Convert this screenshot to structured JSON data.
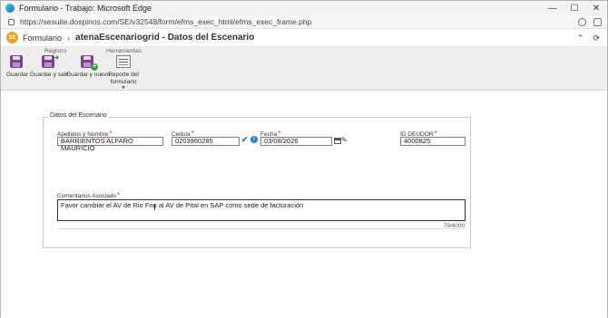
{
  "window": {
    "title": "Formulario - Trabajo: Microsoft Edge",
    "url": "https://sesuite.dospinos.com/SE/v32548/form/efms_exec_html/efms_exec_frame.php"
  },
  "header": {
    "logo_text": "SE",
    "breadcrumb_root": "Formulario",
    "separator": "›",
    "page_title": "atenaEscenariogrid - Datos del Escenario"
  },
  "ribbon": {
    "groups": [
      {
        "label": "Registro"
      },
      {
        "label": "Herramientas"
      }
    ],
    "buttons": [
      {
        "label": "Guardar"
      },
      {
        "label": "Guardar y salir"
      },
      {
        "label": "Guardar y nuevo"
      },
      {
        "label": "Reporte del formulario"
      }
    ]
  },
  "form": {
    "section_title": "Datos del Escenario",
    "fields": {
      "nombre": {
        "label": "Apellidos y Nombre",
        "value": "BARRIENTOS ALFARO MAURICIO"
      },
      "cedula": {
        "label": "Cedula",
        "value": "0203960285"
      },
      "fecha": {
        "label": "Fecha",
        "value": "03/08/2026"
      },
      "deudor": {
        "label": "ID DEUDOR",
        "value": "4000825"
      },
      "comentarios": {
        "label": "Comentarios Asociado",
        "value": "Favor cambiar el AV de Rio Frio al AV de Pital en SAP como sede de facturación"
      }
    },
    "counter": "79/4000",
    "required_mark": "*"
  },
  "icons": {
    "accent": "#2f7ec7",
    "required": "#e03232",
    "brand": "#7d3f8f"
  }
}
